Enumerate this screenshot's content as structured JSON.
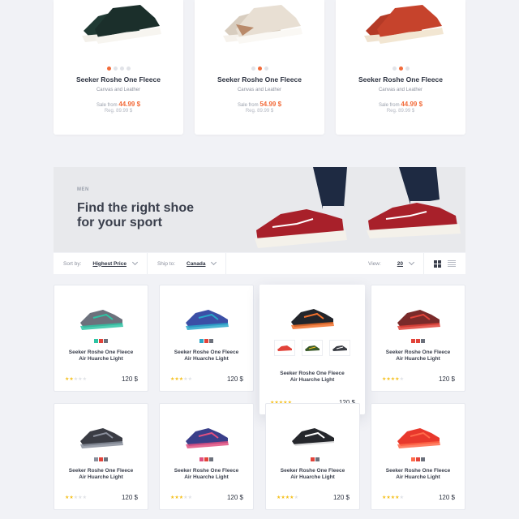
{
  "top_products": [
    {
      "title": "Seeker Roshe One Fleece",
      "subtitle": "Canvas and Leather",
      "sale_label": "Sale from",
      "sale_price": "44.99 $",
      "regular": "Reg. 89.99 $",
      "color": "#1f3a35"
    },
    {
      "title": "Seeker Roshe One Fleece",
      "subtitle": "Canvas and Leather",
      "sale_label": "Sale from",
      "sale_price": "54.99 $",
      "regular": "Reg. 89.99 $",
      "color": "#e6dcd0"
    },
    {
      "title": "Seeker Roshe One Fleece",
      "subtitle": "Canvas and Leather",
      "sale_label": "Sale from",
      "sale_price": "44.99 $",
      "regular": "Reg. 89.99 $",
      "color": "#c2402c"
    }
  ],
  "banner": {
    "eyebrow": "MEN",
    "headline_line1": "Find the right shoe",
    "headline_line2": "for your sport"
  },
  "filters": {
    "sort_label": "Sort by:",
    "sort_value": "Highest Price",
    "ship_label": "Ship to:",
    "ship_value": "Canada",
    "view_label": "View:",
    "view_value": "20"
  },
  "products": [
    {
      "title1": "Seeker Roshe One Fleece",
      "title2": "Air Huarche Light",
      "price": "120 $",
      "rating": 2,
      "color": "#6c717c",
      "accent": "#2fc4a4"
    },
    {
      "title1": "Seeker Roshe One Fleece",
      "title2": "Air Huarche Light",
      "price": "120 $",
      "rating": 3,
      "color": "#3b4fa6",
      "accent": "#2aa7c9"
    },
    {
      "title1": "Seeker Roshe One Fleece",
      "title2": "Air Huarche Light",
      "price": "120 $",
      "rating": 5,
      "color": "#22252b",
      "accent": "#f2712c"
    },
    {
      "title1": "Seeker Roshe One Fleece",
      "title2": "Air Huarche Light",
      "price": "120 $",
      "rating": 4,
      "color": "#7a2a2a",
      "accent": "#e2433a"
    },
    {
      "title1": "Seeker Roshe One Fleece",
      "title2": "Air Huarche Light",
      "price": "120 $",
      "rating": 2,
      "color": "#3a3c44",
      "accent": "#8a8f9c"
    },
    {
      "title1": "Seeker Roshe One Fleece",
      "title2": "Air Huarche Light",
      "price": "120 $",
      "rating": 3,
      "color": "#3a3f8a",
      "accent": "#e05080"
    },
    {
      "title1": "Seeker Roshe One Fleece",
      "title2": "Air Huarche Light",
      "price": "120 $",
      "rating": 4,
      "color": "#25272c",
      "accent": "#ffffff"
    },
    {
      "title1": "Seeker Roshe One Fleece",
      "title2": "Air Huarche Light",
      "price": "120 $",
      "rating": 4,
      "color": "#e8382c",
      "accent": "#ff6a4a"
    }
  ],
  "colors": {
    "accent": "#f26b3a",
    "star": "#f5c120"
  }
}
